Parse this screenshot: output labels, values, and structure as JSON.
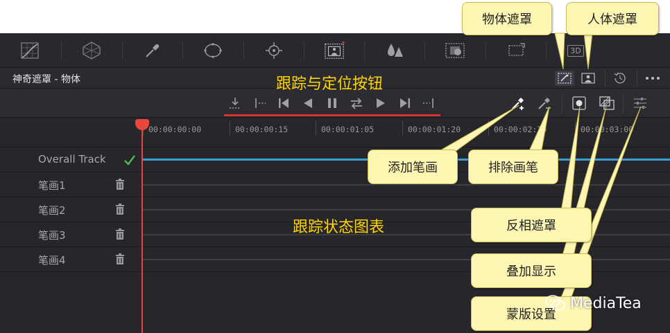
{
  "header": {
    "title": "神奇遮罩 - 物体"
  },
  "annotations": {
    "tracking_buttons": "跟踪与定位按钮",
    "tracking_chart": "跟踪状态图表"
  },
  "callouts": {
    "object_mask": "物体遮罩",
    "person_mask": "人体遮罩",
    "add_stroke": "添加笔画",
    "exclude_brush": "排除画笔",
    "invert_mask": "反相遮罩",
    "overlay_display": "叠加显示",
    "mask_settings": "蒙版设置"
  },
  "toolbar": {
    "label_3d": "3D"
  },
  "ruler": {
    "timecodes": [
      "00:00:00:00",
      "00:00:00:15",
      "00:00:01:05",
      "00:00:01:20",
      "00:00:02:10",
      "00:00:03:00"
    ]
  },
  "tracks": [
    {
      "label": "Overall Track"
    },
    {
      "label": "笔画1"
    },
    {
      "label": "笔画2"
    },
    {
      "label": "笔画3"
    },
    {
      "label": "笔画4"
    }
  ],
  "watermark": {
    "text": "MediaTea"
  },
  "colors": {
    "accent_red": "#e8473e",
    "track_blue": "#3a9fd8",
    "check_green": "#4cc04c",
    "annotation_yellow": "#ffd600"
  }
}
